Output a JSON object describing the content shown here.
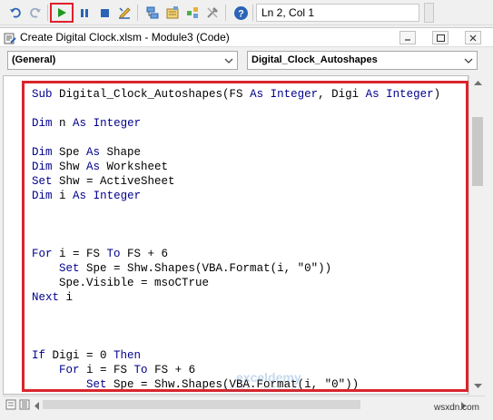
{
  "toolbar": {
    "buttons": [
      {
        "name": "undo-icon"
      },
      {
        "name": "redo-icon"
      },
      {
        "name": "run-icon",
        "highlighted": true
      },
      {
        "name": "pause-icon"
      },
      {
        "name": "stop-icon"
      },
      {
        "name": "design-mode-icon"
      },
      {
        "name": "project-explorer-icon"
      },
      {
        "name": "properties-window-icon"
      },
      {
        "name": "object-browser-icon"
      },
      {
        "name": "toolbox-icon"
      },
      {
        "name": "help-icon"
      }
    ],
    "cursor_position": "Ln 2, Col 1"
  },
  "window": {
    "title": "Create Digital Clock.xlsm - Module3 (Code)"
  },
  "object_dropdown": {
    "value": "(General)"
  },
  "procedure_dropdown": {
    "value": "Digital_Clock_Autoshapes"
  },
  "code": {
    "lines": [
      "Sub Digital_Clock_Autoshapes(FS As Integer, Digi As Integer)",
      "",
      "Dim n As Integer",
      "",
      "Dim Spe As Shape",
      "Dim Shw As Worksheet",
      "Set Shw = ActiveSheet",
      "Dim i As Integer",
      "",
      "",
      "",
      "For i = FS To FS + 6",
      "    Set Spe = Shw.Shapes(VBA.Format(i, \"0\"))",
      "    Spe.Visible = msoCTrue",
      "Next i",
      "",
      "",
      "",
      "If Digi = 0 Then",
      "    For i = FS To FS + 6",
      "        Set Spe = Shw.Shapes(VBA.Format(i, \"0\"))"
    ]
  },
  "watermark": {
    "name": "exceldemy",
    "tagline": "EXCEL · DATA · BI"
  },
  "site": "wsxdn.com",
  "colors": {
    "highlight_border": "#d9242c",
    "keyword": "#00008b",
    "run_green": "#1e9a1e"
  }
}
